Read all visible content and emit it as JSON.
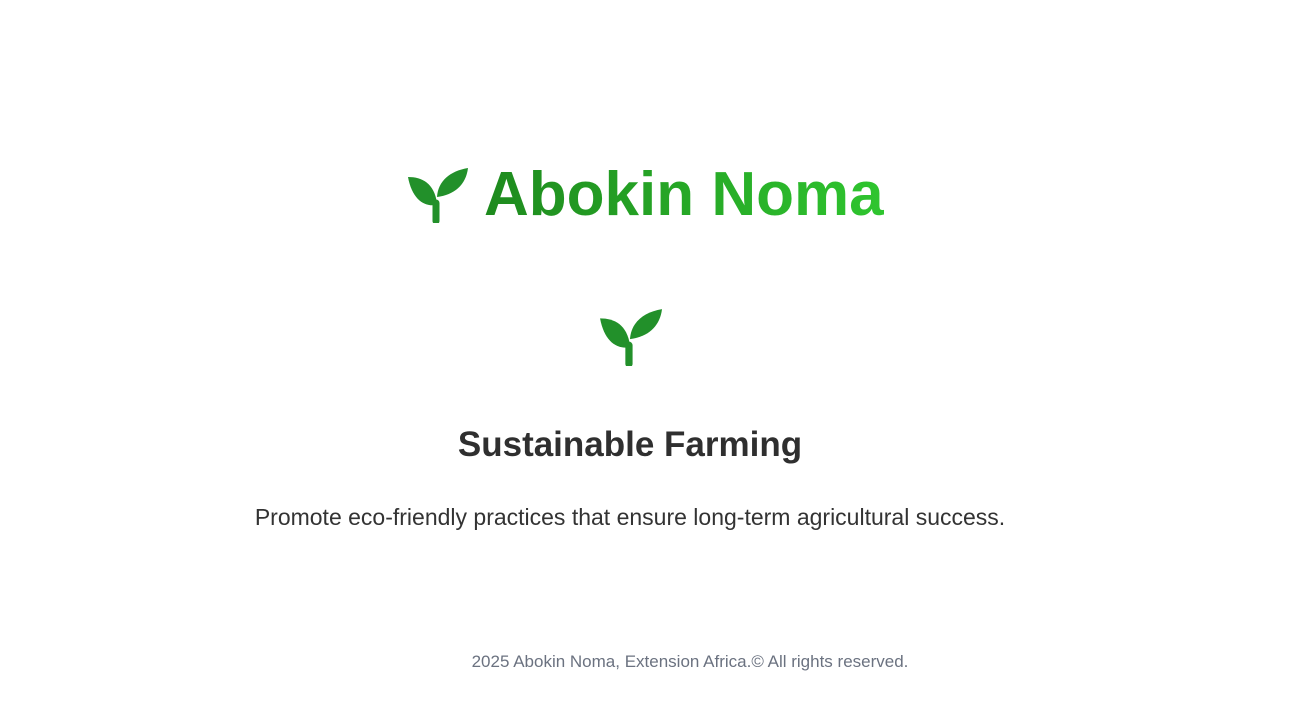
{
  "brand": {
    "name": "Abokin Noma",
    "icon": "seedling-icon",
    "gradient": [
      "#1e8a1e",
      "#2fc52f"
    ]
  },
  "feature": {
    "icon": "seedling-icon",
    "title": "Sustainable Farming",
    "description": "Promote eco-friendly practices that ensure long-term agricultural success."
  },
  "footer": {
    "text": "2025 Abokin Noma, Extension Africa.© All rights reserved."
  },
  "colors": {
    "icon_green": "#22902a",
    "heading": "#2f2f2f",
    "footer_text": "#6b7280"
  }
}
